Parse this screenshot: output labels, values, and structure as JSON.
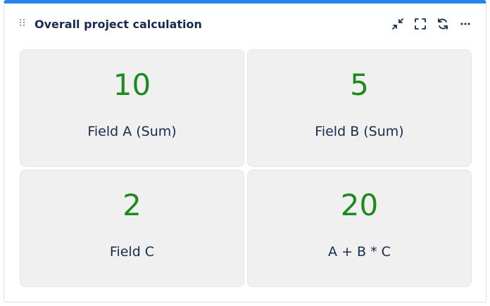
{
  "gadget": {
    "title": "Overall project calculation",
    "accent_color": "#2684e8",
    "value_color": "#1e8a1e",
    "actions": [
      {
        "icon": "collapse-icon"
      },
      {
        "icon": "fullscreen-icon"
      },
      {
        "icon": "refresh-icon"
      },
      {
        "icon": "more-icon"
      }
    ]
  },
  "tiles": [
    {
      "value": "10",
      "label": "Field A (Sum)"
    },
    {
      "value": "5",
      "label": "Field B (Sum)"
    },
    {
      "value": "2",
      "label": "Field C"
    },
    {
      "value": "20",
      "label": "A + B * C"
    }
  ]
}
